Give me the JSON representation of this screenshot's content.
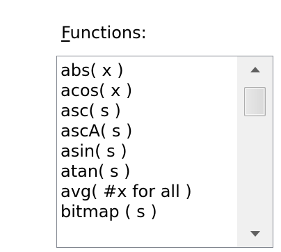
{
  "functions_panel": {
    "label_mnemonic": "F",
    "label_rest": "unctions:",
    "items": [
      "abs( x )",
      "acos( x )",
      "asc( s )",
      "ascA( s )",
      "asin( s )",
      "atan( s )",
      "avg( #x for all )",
      "bitmap ( s )"
    ],
    "scrollbar": {
      "up_icon": "triangle-up",
      "down_icon": "triangle-down",
      "position": 0.05
    }
  }
}
